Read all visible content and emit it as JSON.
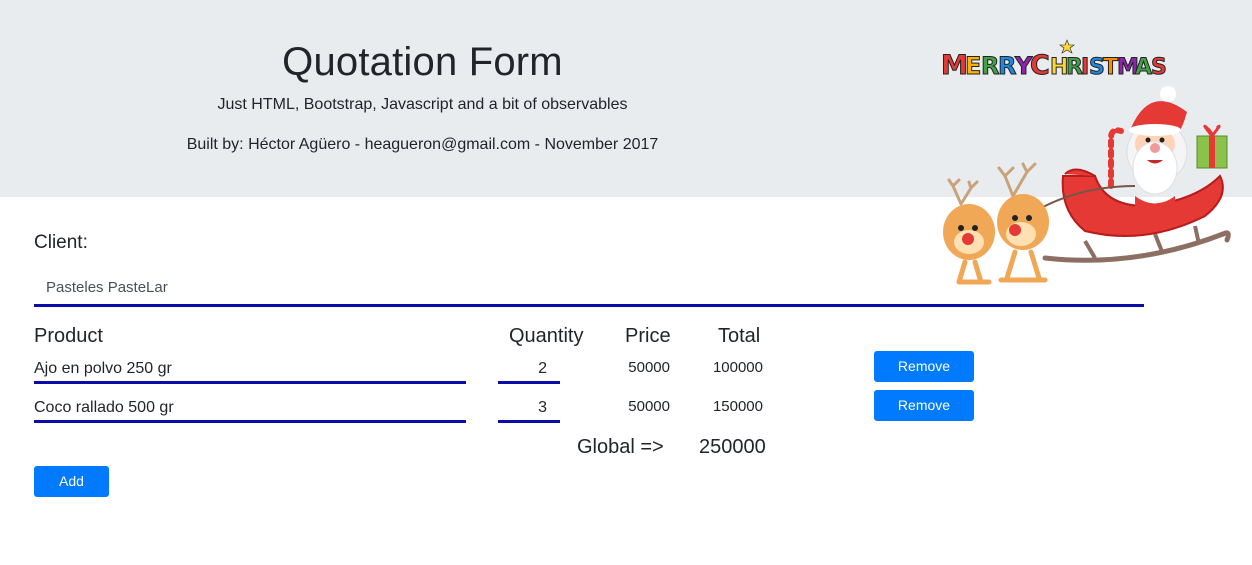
{
  "header": {
    "title": "Quotation Form",
    "subtitle": "Just HTML, Bootstrap, Javascript and a bit of observables",
    "built_by": "Built by: Héctor Agüero - heagueron@gmail.com - November 2017",
    "banner_text": "MERRY CHRISTMAS"
  },
  "client": {
    "label": "Client:",
    "value": "Pasteles PasteLar"
  },
  "table": {
    "headers": {
      "product": "Product",
      "quantity": "Quantity",
      "price": "Price",
      "total": "Total"
    },
    "rows": [
      {
        "product": "Ajo en polvo 250 gr",
        "quantity": "2",
        "price": "50000",
        "total": "100000",
        "remove_label": "Remove item"
      },
      {
        "product": "Coco rallado 500 gr",
        "quantity": "3",
        "price": "50000",
        "total": "150000",
        "remove_label": "Remove item"
      }
    ],
    "global_label": "Global =>",
    "global_value": "250000"
  },
  "actions": {
    "add_label": "Add item"
  },
  "colors": {
    "header_bg": "#e9ecef",
    "primary": "#007bff",
    "underline": "#0b0ba7"
  }
}
